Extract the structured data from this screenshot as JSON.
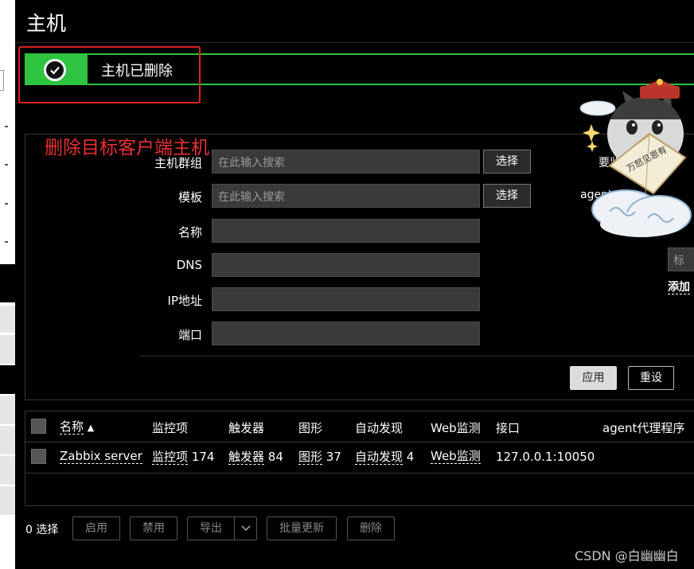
{
  "page": {
    "title": "主机"
  },
  "message": {
    "text": "主机已删除",
    "accent": "#2fc440"
  },
  "annotation": {
    "text": "删除目标客户端主机",
    "color": "#e8302f"
  },
  "filter": {
    "host_group": {
      "label": "主机群组",
      "placeholder": "在此输入搜索",
      "button": "选择"
    },
    "template": {
      "label": "模板",
      "placeholder": "在此输入搜索",
      "button": "选择"
    },
    "name": {
      "label": "名称",
      "value": ""
    },
    "dns": {
      "label": "DNS",
      "value": ""
    },
    "ip": {
      "label": "IP地址",
      "value": ""
    },
    "port": {
      "label": "端口",
      "value": ""
    },
    "right": {
      "monitored_by_partial": "要监",
      "agent_partial": "agent",
      "tag_placeholder_partial": "标记",
      "add_link": "添加"
    },
    "apply_label": "应用",
    "reset_label": "重设"
  },
  "sticker": {
    "fan_text": "万怒见恩有",
    "icon": "lucky-cat-sticker"
  },
  "table": {
    "headers": {
      "name": "名称",
      "sort_indicator": "▲",
      "items": "监控项",
      "triggers": "触发器",
      "graphs": "图形",
      "discovery": "自动发现",
      "web": "Web监测",
      "interface": "接口",
      "proxy": "agent代理程序"
    },
    "rows": [
      {
        "name": "Zabbix server",
        "items_label": "监控项",
        "items_count": "174",
        "triggers_label": "触发器",
        "triggers_count": "84",
        "graphs_label": "图形",
        "graphs_count": "37",
        "discovery_label": "自动发现",
        "discovery_count": "4",
        "web_label": "Web监测",
        "interface": "127.0.0.1:10050"
      }
    ]
  },
  "footer": {
    "selected": "0 选择",
    "enable": "启用",
    "disable": "禁用",
    "export": "导出",
    "mass_update": "批量更新",
    "delete": "删除"
  },
  "watermark": "CSDN @白幽幽白"
}
